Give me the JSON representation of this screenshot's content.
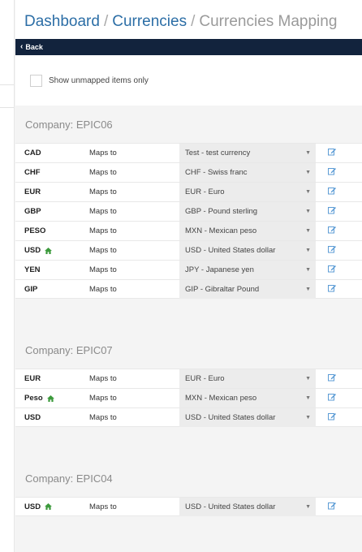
{
  "breadcrumb": {
    "items": [
      "Dashboard",
      "Currencies",
      "Currencies Mapping"
    ],
    "separator": "/"
  },
  "toolbar": {
    "back_label": "Back"
  },
  "filter": {
    "label": "Show unmapped items only",
    "checked": false
  },
  "mapping_label": "Maps to",
  "colors": {
    "nav_bg": "#12233d",
    "link": "#2c6ea6",
    "home_icon": "#3c9a3c",
    "edit_icon": "#5b9bd5"
  },
  "companies": [
    {
      "header": "Company: EPIC06",
      "rows": [
        {
          "code": "CAD",
          "home": false,
          "mapped": "Test - test currency"
        },
        {
          "code": "CHF",
          "home": false,
          "mapped": "CHF - Swiss franc"
        },
        {
          "code": "EUR",
          "home": false,
          "mapped": "EUR - Euro"
        },
        {
          "code": "GBP",
          "home": false,
          "mapped": "GBP - Pound sterling"
        },
        {
          "code": "PESO",
          "home": false,
          "mapped": "MXN - Mexican peso"
        },
        {
          "code": "USD",
          "home": true,
          "mapped": "USD - United States dollar"
        },
        {
          "code": "YEN",
          "home": false,
          "mapped": "JPY - Japanese yen"
        },
        {
          "code": "GIP",
          "home": false,
          "mapped": "GIP - Gibraltar Pound"
        }
      ]
    },
    {
      "header": "Company: EPIC07",
      "rows": [
        {
          "code": "EUR",
          "home": false,
          "mapped": "EUR - Euro"
        },
        {
          "code": "Peso",
          "home": true,
          "mapped": "MXN - Mexican peso"
        },
        {
          "code": "USD",
          "home": false,
          "mapped": "USD - United States dollar"
        }
      ]
    },
    {
      "header": "Company: EPIC04",
      "rows": [
        {
          "code": "USD",
          "home": true,
          "mapped": "USD - United States dollar"
        }
      ]
    }
  ]
}
